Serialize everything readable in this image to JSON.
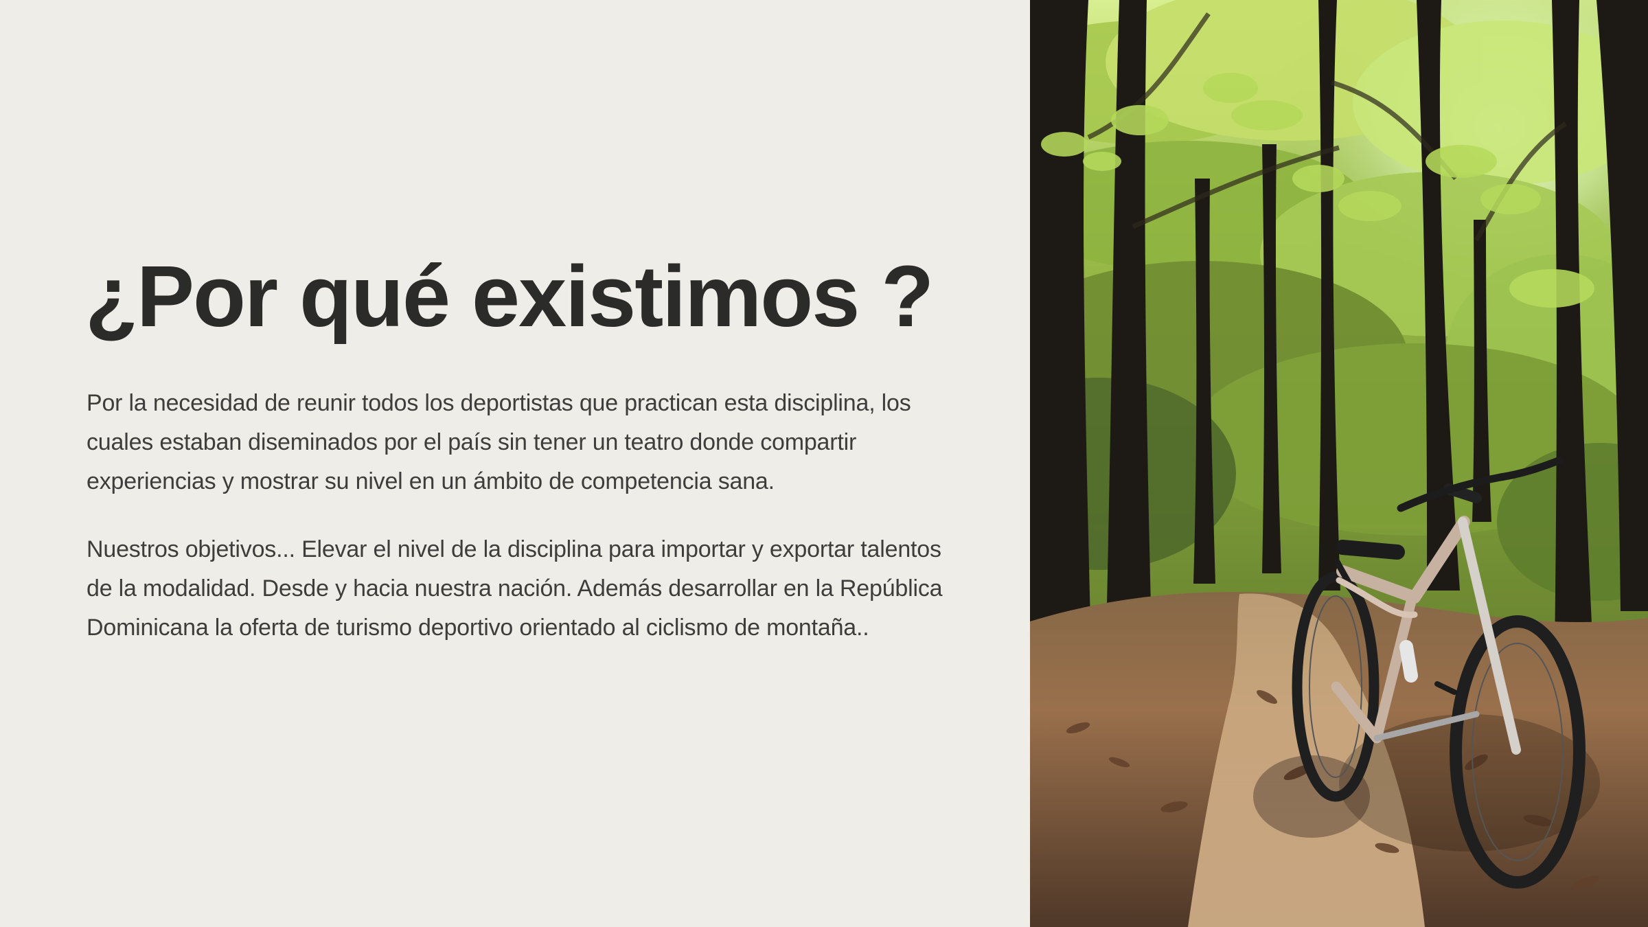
{
  "slide": {
    "title": "¿Por qué existimos ?",
    "paragraphs": [
      "Por la necesidad de reunir todos los deportistas que practican esta disciplina, los cuales estaban diseminados por el país sin tener un teatro donde compartir experiencias y mostrar su nivel en un ámbito de competencia sana.",
      "Nuestros objetivos... Elevar el nivel de la disciplina para importar y exportar talentos de la modalidad. Desde y hacia nuestra nación. Además desarrollar en la República Dominicana la oferta de turismo deportivo orientado al ciclismo de montaña.."
    ]
  },
  "image": {
    "subject": "forest-trail-with-mountain-bike",
    "colors": {
      "background": "#efede8",
      "text": "#2b2b2a",
      "forest_light": "#cfe47a",
      "forest_mid": "#7f9e36",
      "forest_dark": "#263015",
      "trail": "#b88b5c",
      "trunk": "#1d1914",
      "bike": "#2a2a2a"
    }
  }
}
